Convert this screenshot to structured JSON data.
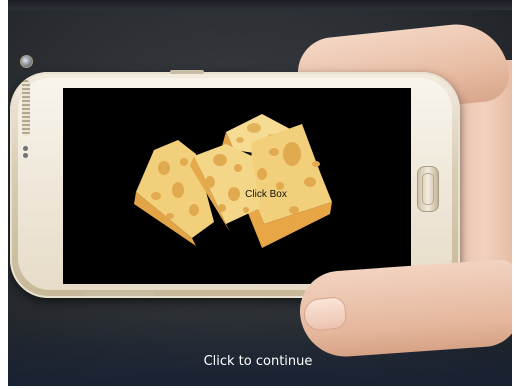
{
  "slide": {
    "click_box_label": "Click Box",
    "continue_prompt": "Click to continue"
  },
  "colors": {
    "screen": "#000000",
    "cheese": "#f2cf7a",
    "cheese_shadow": "#e2a446",
    "prompt_text": "#ffffff"
  },
  "icons": {
    "artwork": "cheese-wedges-illustration",
    "device": "smartphone-in-hand-photo"
  }
}
